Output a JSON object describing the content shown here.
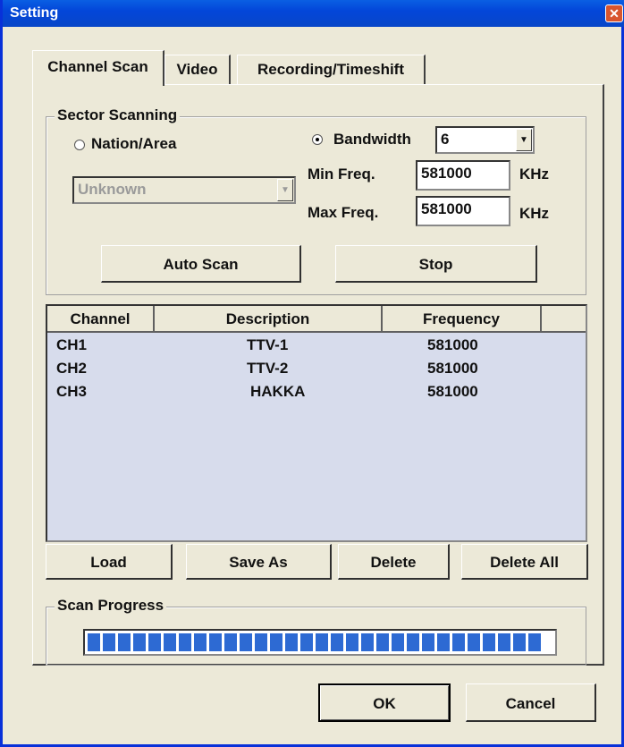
{
  "window": {
    "title": "Setting",
    "close_glyph": "✕"
  },
  "tabs": [
    {
      "label": "Channel Scan",
      "active": true
    },
    {
      "label": "Video",
      "active": false
    },
    {
      "label": "Recording/Timeshift",
      "active": false
    }
  ],
  "sector": {
    "group_label": "Sector Scanning",
    "nation_label": "Nation/Area",
    "nation_value": "Unknown",
    "bandwidth_label": "Bandwidth",
    "bandwidth_value": "6",
    "min_label": "Min Freq.",
    "min_value": "581000",
    "max_label": "Max Freq.",
    "max_value": "581000",
    "unit": "KHz",
    "auto_scan_label": "Auto Scan",
    "stop_label": "Stop"
  },
  "table": {
    "columns": [
      "Channel",
      "Description",
      "Frequency"
    ],
    "rows": [
      {
        "channel": "CH1",
        "description": "TTV-1",
        "frequency": "581000"
      },
      {
        "channel": "CH2",
        "description": "TTV-2",
        "frequency": "581000"
      },
      {
        "channel": "CH3",
        "description": "HAKKA",
        "frequency": "581000"
      }
    ]
  },
  "list_buttons": {
    "load": "Load",
    "save_as": "Save As",
    "delete": "Delete",
    "delete_all": "Delete All"
  },
  "progress": {
    "group_label": "Scan Progress",
    "fraction": 1.0,
    "color": "#2d6ad3"
  },
  "footer": {
    "ok": "OK",
    "cancel": "Cancel"
  },
  "colors": {
    "title_bar": "#0346d9",
    "list_bg": "#d7dcec",
    "dialog_bg": "#ece9d8"
  }
}
